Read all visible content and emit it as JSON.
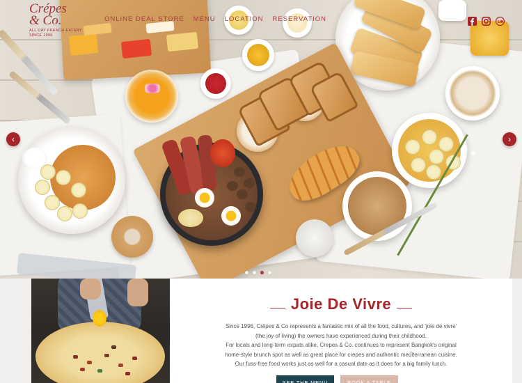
{
  "brand": {
    "name_line1": "Crépes",
    "name_line2": "& Co.",
    "tagline_line1": "ALL DAY FRENCH EATERY",
    "tagline_line2": "SINCE 1996",
    "color": "#9b3339"
  },
  "nav": {
    "items": [
      {
        "label": "ONLINE DEAL STORE"
      },
      {
        "label": "MENU"
      },
      {
        "label": "LOCATION"
      },
      {
        "label": "RESERVATION"
      }
    ]
  },
  "social": {
    "icons": [
      "facebook-icon",
      "instagram-icon",
      "line-icon"
    ]
  },
  "slider": {
    "prev_symbol": "‹",
    "next_symbol": "›",
    "slide_count": 4,
    "active_slide": 3
  },
  "intro": {
    "heading": "Joie De Vivre",
    "paragraph_lines": [
      "Since 1996, Crêpes & Co represents a fantastic mix of all the food, cultures, and 'joie de vivre'",
      "(the joy of living) the owners have experienced during their childhood.",
      "For locals and long-term expats alike, Crepes & Co. continues to represent Bangkok's original",
      "home-style brunch spot as well as great place for crepes and authentic mediterranean cuisine.",
      "Our fuss-free food works just as well for a casual date as it does for a big family lunch."
    ],
    "buttons": {
      "menu_label": "SEE THE MENU",
      "book_label": "BOOK A TABLE"
    }
  },
  "colors": {
    "accent": "#a5252b",
    "button_menu": "#1f4452",
    "button_book": "#d9b7a9"
  }
}
